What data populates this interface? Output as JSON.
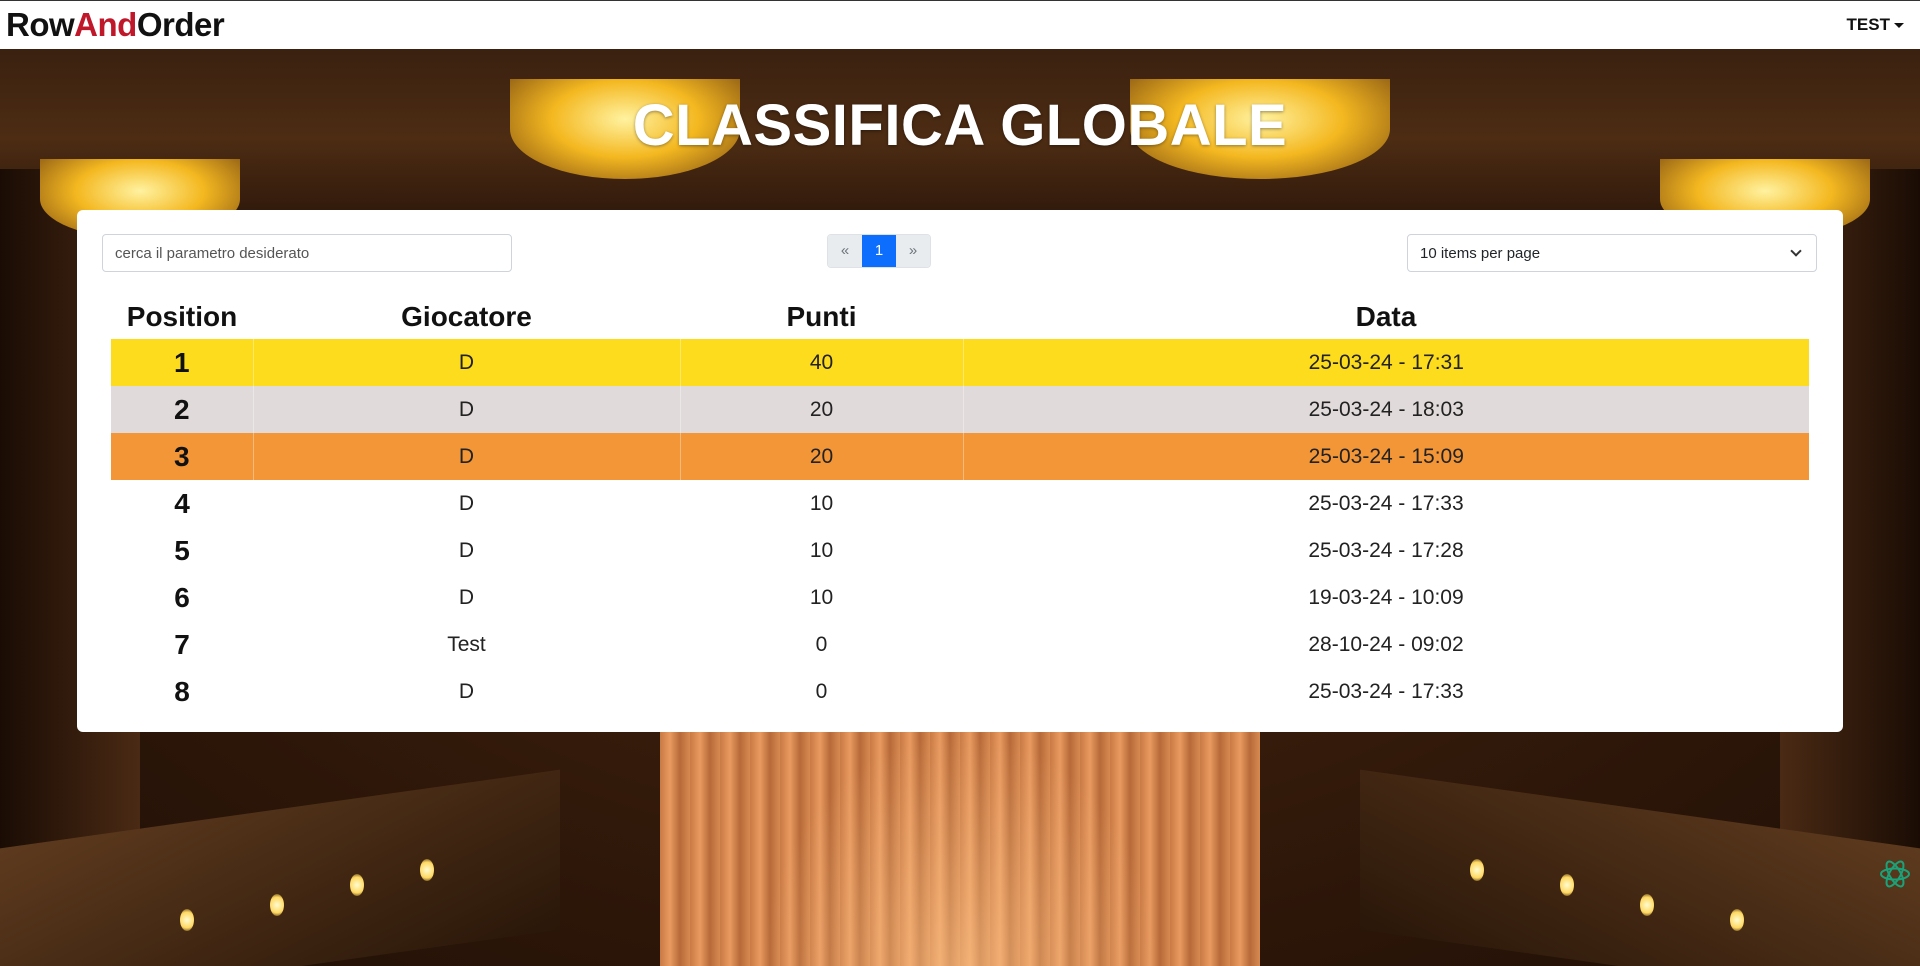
{
  "navbar": {
    "brand_part1": "Row",
    "brand_part2": "And",
    "brand_part3": "Order",
    "user_label": "TEST"
  },
  "page": {
    "title": "CLASSIFICA GLOBALE"
  },
  "controls": {
    "search_placeholder": "cerca il parametro desiderato",
    "pager_prev": "«",
    "pager_current": "1",
    "pager_next": "»",
    "items_per_page": "10 items per page"
  },
  "table": {
    "headers": [
      "Position",
      "Giocatore",
      "Punti",
      "Data"
    ],
    "rows": [
      {
        "position": "1",
        "player": "D",
        "points": "40",
        "date": "25-03-24 - 17:31"
      },
      {
        "position": "2",
        "player": "D",
        "points": "20",
        "date": "25-03-24 - 18:03"
      },
      {
        "position": "3",
        "player": "D",
        "points": "20",
        "date": "25-03-24 - 15:09"
      },
      {
        "position": "4",
        "player": "D",
        "points": "10",
        "date": "25-03-24 - 17:33"
      },
      {
        "position": "5",
        "player": "D",
        "points": "10",
        "date": "25-03-24 - 17:28"
      },
      {
        "position": "6",
        "player": "D",
        "points": "10",
        "date": "19-03-24 - 10:09"
      },
      {
        "position": "7",
        "player": "Test",
        "points": "0",
        "date": "28-10-24 - 09:02"
      },
      {
        "position": "8",
        "player": "D",
        "points": "0",
        "date": "25-03-24 - 17:33"
      }
    ]
  },
  "colors": {
    "brand_accent": "#c0182b",
    "gold": "#fddc1e",
    "silver": "#e1dada",
    "bronze": "#f29637",
    "pager_active": "#0d6efd"
  },
  "icons": {
    "floating_button": "assistant-icon"
  }
}
